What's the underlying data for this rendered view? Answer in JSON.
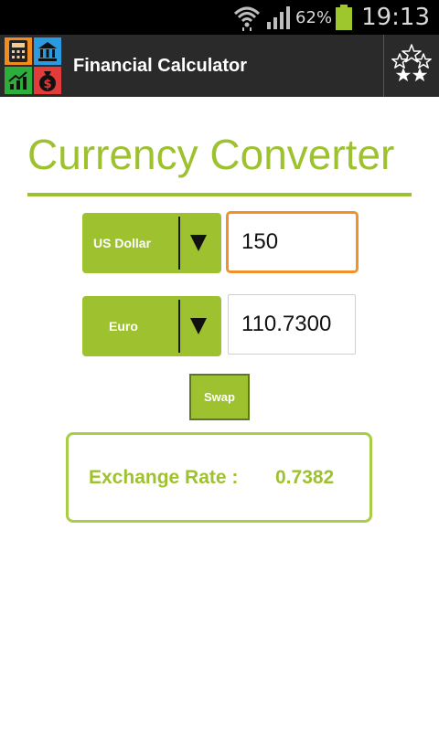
{
  "status_bar": {
    "battery_percent": "62%",
    "time": "19:13",
    "icons": [
      "wifi-icon",
      "signal-icon",
      "battery-icon"
    ]
  },
  "action_bar": {
    "app_icon": "financial-calculator-app-icon",
    "title": "Financial Calculator",
    "rate_icon": "stars-icon"
  },
  "converter": {
    "heading": "Currency Converter",
    "from_currency": "US Dollar",
    "from_amount": "150",
    "to_currency": "Euro",
    "to_amount": "110.7300",
    "swap_label": "Swap",
    "rate_label": "Exchange Rate :",
    "rate_value": "0.7382"
  },
  "colors": {
    "accent": "#9ec22f",
    "focus_border": "#f0922b",
    "action_bar": "#2a2a2a",
    "status_bar": "#000000"
  }
}
